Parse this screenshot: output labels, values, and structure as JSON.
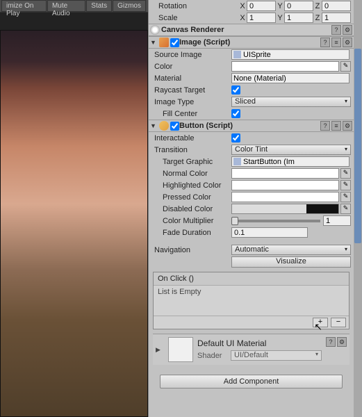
{
  "toolbar": {
    "maxplay": "imize On Play",
    "mute": "Mute Audio",
    "stats": "Stats",
    "gizmos": "Gizmos"
  },
  "transform": {
    "rotation": {
      "label": "Rotation",
      "x": "0",
      "y": "0",
      "z": "0"
    },
    "scale": {
      "label": "Scale",
      "x": "1",
      "y": "1",
      "z": "1"
    }
  },
  "canvasRenderer": {
    "title": "Canvas Renderer"
  },
  "image": {
    "title": "Image (Script)",
    "sourceImage": {
      "label": "Source Image",
      "value": "UISprite"
    },
    "color": {
      "label": "Color"
    },
    "material": {
      "label": "Material",
      "value": "None (Material)"
    },
    "raycast": {
      "label": "Raycast Target"
    },
    "imageType": {
      "label": "Image Type",
      "value": "Sliced"
    },
    "fillCenter": {
      "label": "Fill Center"
    }
  },
  "button": {
    "title": "Button (Script)",
    "interactable": {
      "label": "Interactable"
    },
    "transition": {
      "label": "Transition",
      "value": "Color Tint"
    },
    "targetGraphic": {
      "label": "Target Graphic",
      "value": "StartButton (Im"
    },
    "normalColor": {
      "label": "Normal Color"
    },
    "highlightedColor": {
      "label": "Highlighted Color"
    },
    "pressedColor": {
      "label": "Pressed Color"
    },
    "disabledColor": {
      "label": "Disabled Color"
    },
    "colorMultiplier": {
      "label": "Color Multiplier",
      "value": "1"
    },
    "fadeDuration": {
      "label": "Fade Duration",
      "value": "0.1"
    },
    "navigation": {
      "label": "Navigation",
      "value": "Automatic"
    },
    "visualize": "Visualize",
    "onClick": {
      "title": "On Click ()",
      "empty": "List is Empty"
    }
  },
  "material": {
    "title": "Default UI Material",
    "shaderLabel": "Shader",
    "shaderValue": "UI/Default"
  },
  "addComponent": "Add Component"
}
